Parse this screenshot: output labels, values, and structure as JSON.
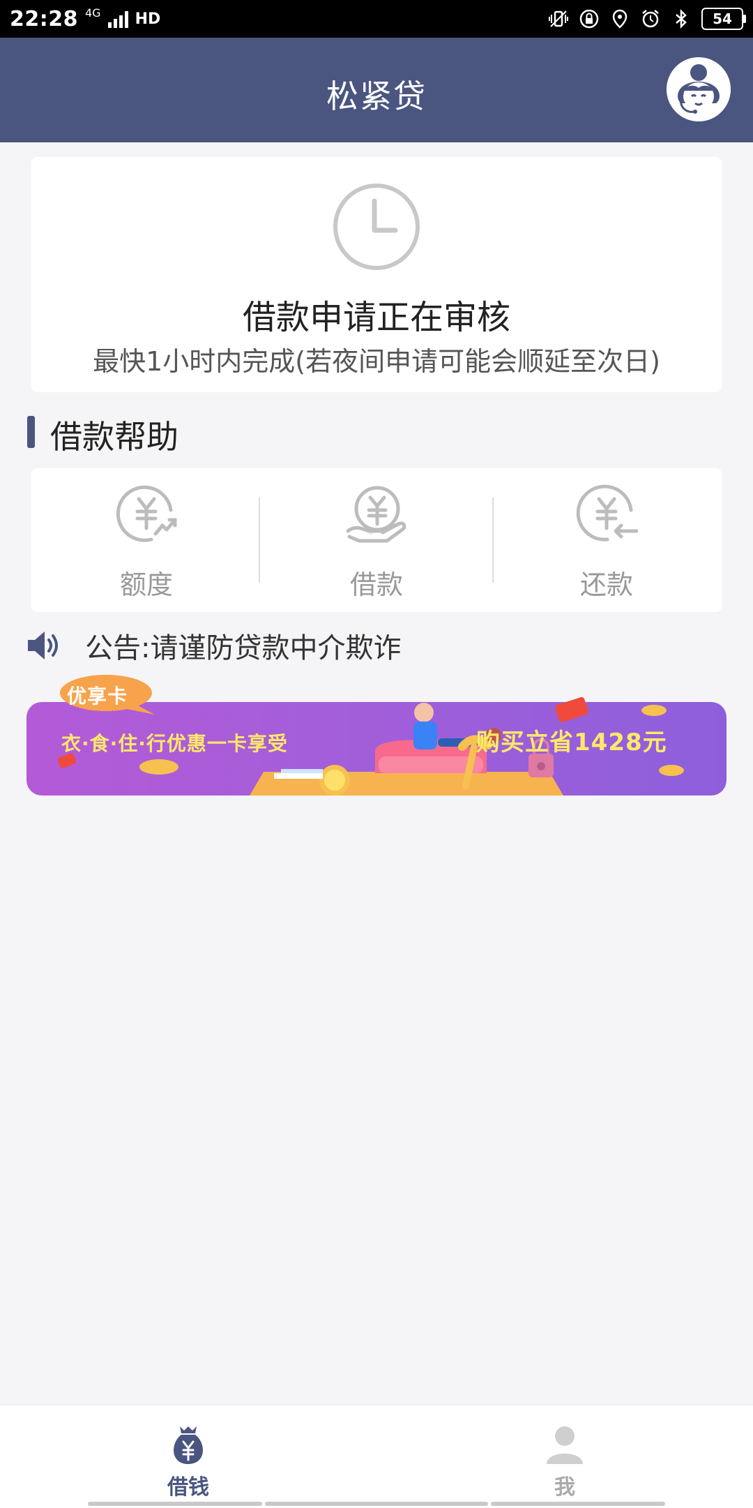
{
  "status_bar": {
    "time": "22:28",
    "network": "4G",
    "hd": "HD",
    "battery": "54"
  },
  "header": {
    "title": "松紧贷"
  },
  "review_status": {
    "title": "借款申请正在审核",
    "subtitle": "最快1小时内完成(若夜间申请可能会顺延至次日)"
  },
  "help": {
    "title": "借款帮助",
    "items": [
      {
        "label": "额度",
        "icon": "quota-icon"
      },
      {
        "label": "借款",
        "icon": "borrow-icon"
      },
      {
        "label": "还款",
        "icon": "repay-icon"
      }
    ]
  },
  "notice": {
    "text": "公告:请谨防贷款中介欺诈"
  },
  "promo": {
    "tag": "优享卡",
    "left_text": "衣·食·住·行优惠一卡享受",
    "right_text": "购买立省1428元"
  },
  "bottom_nav": {
    "items": [
      {
        "label": "借钱",
        "icon": "money-bag-icon",
        "active": true
      },
      {
        "label": "我",
        "icon": "user-icon",
        "active": false
      }
    ]
  },
  "colors": {
    "brand": "#4a5580",
    "muted": "#999999",
    "promo": "#a35ed9",
    "promo_text": "#ffe86a"
  }
}
